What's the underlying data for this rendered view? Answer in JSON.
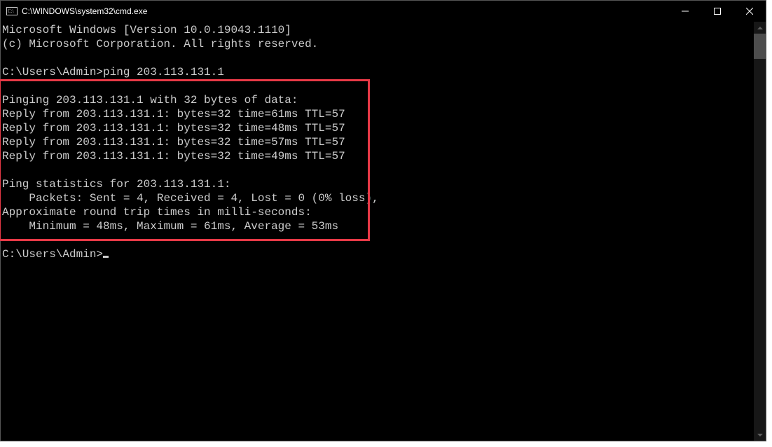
{
  "window": {
    "title": "C:\\WINDOWS\\system32\\cmd.exe"
  },
  "terminal": {
    "version_line": "Microsoft Windows [Version 10.0.19043.1110]",
    "copyright_line": "(c) Microsoft Corporation. All rights reserved.",
    "prompt1": "C:\\Users\\Admin>",
    "command1": "ping 203.113.131.1",
    "ping_header": "Pinging 203.113.131.1 with 32 bytes of data:",
    "reply1": "Reply from 203.113.131.1: bytes=32 time=61ms TTL=57",
    "reply2": "Reply from 203.113.131.1: bytes=32 time=48ms TTL=57",
    "reply3": "Reply from 203.113.131.1: bytes=32 time=57ms TTL=57",
    "reply4": "Reply from 203.113.131.1: bytes=32 time=49ms TTL=57",
    "stats_header": "Ping statistics for 203.113.131.1:",
    "packets_line": "    Packets: Sent = 4, Received = 4, Lost = 0 (0% loss),",
    "approx_line": "Approximate round trip times in milli-seconds:",
    "rtt_line": "    Minimum = 48ms, Maximum = 61ms, Average = 53ms",
    "prompt2": "C:\\Users\\Admin>"
  }
}
